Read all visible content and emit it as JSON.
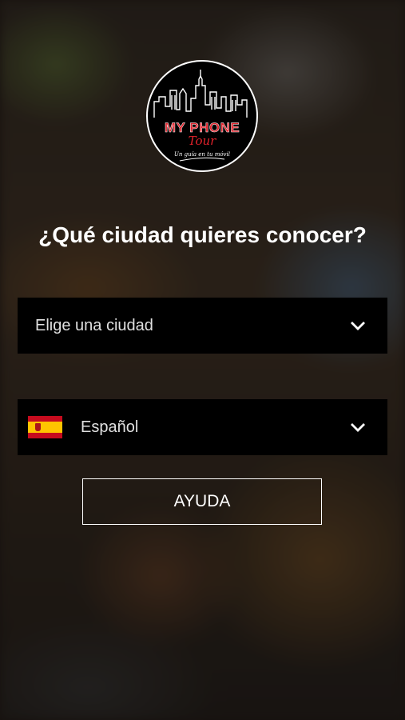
{
  "logo": {
    "title": "MY PHONE",
    "script": "Tour",
    "tagline": "Un guía en tu móvil"
  },
  "heading": "¿Qué ciudad quieres conocer?",
  "city_select": {
    "label": "Elige una ciudad",
    "icon": "chevron-down-icon"
  },
  "language_select": {
    "label": "Español",
    "flag": "spain-flag-icon",
    "icon": "chevron-down-icon"
  },
  "help_button": {
    "label": "AYUDA"
  },
  "colors": {
    "brand_red": "#e3222b",
    "field_bg": "#000000",
    "text": "#ffffff"
  }
}
